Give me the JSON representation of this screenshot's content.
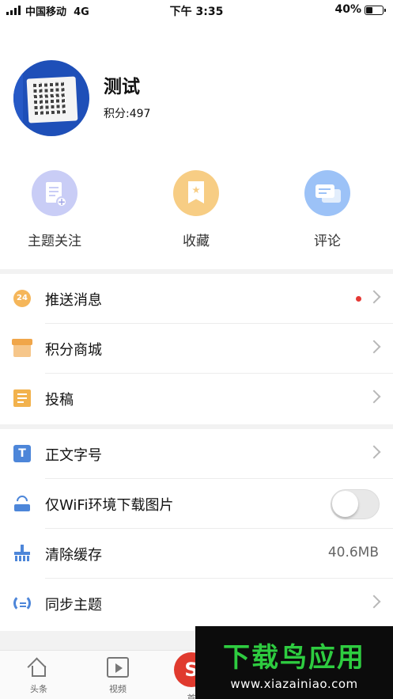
{
  "status_bar": {
    "carrier": "中国移动",
    "network": "4G",
    "time": "下午 3:35",
    "battery_percent": "40%",
    "battery_level": 0.4
  },
  "profile": {
    "name": "测试",
    "points": "积分:497"
  },
  "actions": [
    {
      "label": "主题关注",
      "icon": "document-plus-icon",
      "color": "#c9cdf6"
    },
    {
      "label": "收藏",
      "icon": "bookmark-star-icon",
      "color": "#f7cd84"
    },
    {
      "label": "评论",
      "icon": "chat-bubbles-icon",
      "color": "#9cc2f7"
    }
  ],
  "menu_group_1": [
    {
      "label": "推送消息",
      "icon": "push-24-icon",
      "icon_text": "24",
      "has_dot": true
    },
    {
      "label": "积分商城",
      "icon": "shop-icon"
    },
    {
      "label": "投稿",
      "icon": "note-icon"
    }
  ],
  "menu_group_2": [
    {
      "label": "正文字号",
      "icon": "font-size-icon",
      "icon_text": "T"
    },
    {
      "label": "仅WiFi环境下载图片",
      "icon": "wifi-router-icon",
      "toggle": false
    },
    {
      "label": "清除缓存",
      "icon": "broom-icon",
      "value": "40.6MB"
    },
    {
      "label": "同步主题",
      "icon": "sync-icon"
    }
  ],
  "tabbar": {
    "tabs": [
      {
        "label": "头条",
        "icon": "home-icon"
      },
      {
        "label": "视频",
        "icon": "video-icon"
      },
      {
        "label": "首",
        "icon": "app-home-red-icon"
      }
    ]
  },
  "watermark": {
    "title": "下载鸟应用",
    "url": "www.xiazainiao.com"
  },
  "colors": {
    "accent_blue": "#4d86d9",
    "red_dot": "#e53935",
    "watermark_green": "#2ecc40"
  }
}
